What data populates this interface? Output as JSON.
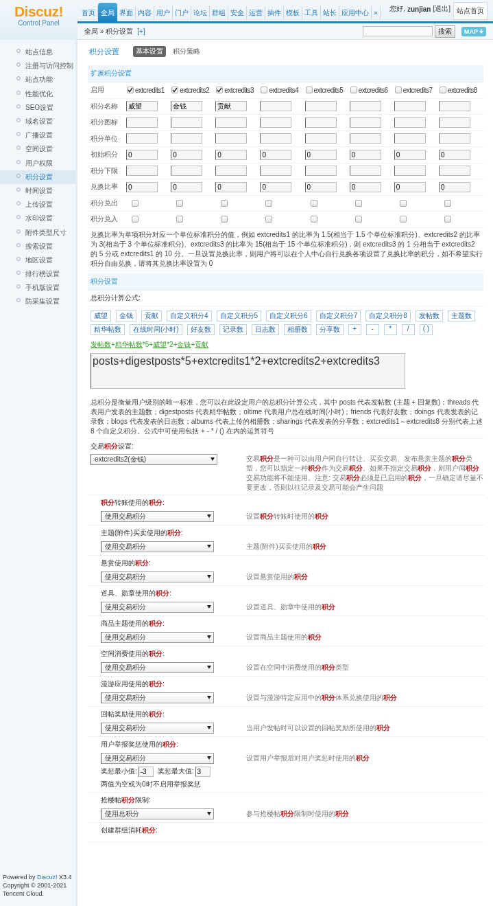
{
  "header": {
    "logo": {
      "title": "Discuz!",
      "subtitle": "Control Panel"
    },
    "nav": [
      {
        "label": "首页",
        "selected": false
      },
      {
        "label": "全局",
        "selected": true
      },
      {
        "label": "界面",
        "selected": false
      },
      {
        "label": "内容",
        "selected": false
      },
      {
        "label": "用户",
        "selected": false
      },
      {
        "label": "门户",
        "selected": false
      },
      {
        "label": "论坛",
        "selected": false
      },
      {
        "label": "群组",
        "selected": false
      },
      {
        "label": "安全",
        "selected": false
      },
      {
        "label": "运营",
        "selected": false
      },
      {
        "label": "插件",
        "selected": false
      },
      {
        "label": "模板",
        "selected": false
      },
      {
        "label": "工具",
        "selected": false
      },
      {
        "label": "站长",
        "selected": false
      },
      {
        "label": "应用中心",
        "selected": false
      },
      {
        "label": "»",
        "selected": false
      }
    ],
    "greeting": "您好,",
    "user": "zunjian",
    "logout": "[退出]",
    "home_button": "站点首页"
  },
  "toolbar": {
    "breadcrumb": "全局 » 积分设置",
    "add_link": "[+]",
    "search_button": "搜索",
    "map_button": "MAP"
  },
  "sidebar": {
    "items": [
      {
        "label": "站点信息",
        "selected": false
      },
      {
        "label": "注册与访问控制",
        "selected": false
      },
      {
        "label": "站点功能",
        "selected": false
      },
      {
        "label": "性能优化",
        "selected": false
      },
      {
        "label": "SEO设置",
        "selected": false
      },
      {
        "label": "域名设置",
        "selected": false
      },
      {
        "label": "广播设置",
        "selected": false
      },
      {
        "label": "空间设置",
        "selected": false
      },
      {
        "label": "用户权限",
        "selected": false
      },
      {
        "label": "积分设置",
        "selected": true
      },
      {
        "label": "时间设置",
        "selected": false
      },
      {
        "label": "上传设置",
        "selected": false
      },
      {
        "label": "水印设置",
        "selected": false
      },
      {
        "label": "附件类型尺寸",
        "selected": false
      },
      {
        "label": "搜索设置",
        "selected": false
      },
      {
        "label": "地区设置",
        "selected": false
      },
      {
        "label": "排行榜设置",
        "selected": false
      },
      {
        "label": "手机版设置",
        "selected": false
      },
      {
        "label": "防采集设置",
        "selected": false
      }
    ],
    "footer": {
      "powered_prefix": "Powered by",
      "powered_link": "Discuz!",
      "powered_suffix": "X3.4",
      "copyright": "Copyright © 2001-2021",
      "company": "Tencent Cloud."
    }
  },
  "page": {
    "title": "积分设置",
    "tabs": [
      {
        "label": "基本设置",
        "selected": true
      },
      {
        "label": "积分策略",
        "selected": false
      }
    ]
  },
  "ext": {
    "heading": "扩展积分设置",
    "rows": [
      {
        "kind": "enable",
        "label": "启用",
        "cells": [
          {
            "label": "extcredits1",
            "checked": true
          },
          {
            "label": "extcredits2",
            "checked": true
          },
          {
            "label": "extcredits3",
            "checked": true
          },
          {
            "label": "extcredits4",
            "checked": false
          },
          {
            "label": "extcredits5",
            "checked": false
          },
          {
            "label": "extcredits6",
            "checked": false
          },
          {
            "label": "extcredits7",
            "checked": false
          },
          {
            "label": "extcredits8",
            "checked": false
          }
        ]
      },
      {
        "kind": "input",
        "label": "积分名称",
        "values": [
          "威望",
          "金钱",
          "贡献"
        ]
      },
      {
        "kind": "input",
        "label": "积分图标"
      },
      {
        "kind": "input",
        "label": "积分单位"
      },
      {
        "kind": "input",
        "label": "初始积分",
        "values": [
          "0",
          "0",
          "0",
          "0",
          "0",
          "0",
          "0",
          "0"
        ]
      },
      {
        "kind": "input",
        "label": "积分下限"
      },
      {
        "kind": "input",
        "label": "兑换比率",
        "values": [
          "0",
          "0",
          "0",
          "0",
          "0",
          "0",
          "0",
          "0"
        ]
      },
      {
        "kind": "checks",
        "label": "积分兑出",
        "checked": [
          false,
          false,
          false,
          false,
          false,
          false,
          false,
          false
        ]
      },
      {
        "kind": "checks",
        "label": "积分兑入",
        "checked": [
          false,
          false,
          false,
          false,
          false,
          false,
          false,
          false
        ]
      }
    ],
    "note": "兑换比率为单项积分对应一个单位标准积分的值，例如 extcredits1 的比率为 1.5(相当于 1.5 个单位标准积分)、extcredits2 的比率为 3(相当于 3 个单位标准积分)、extcredits3 的比率为 15(相当于 15 个单位标准积分)，则 extcredits3 的 1 分相当于 extcredits2 的 5 分或 extcredits1 的 10 分。一旦设置兑换比率，则用户将可以在个人中心自行兑换各项设置了兑换比率的积分，如不希望实行积分自由兑换，请将其兑换比率设置为 0"
  },
  "credits": {
    "heading": "积分设置",
    "formula_label": "总积分计算公式:",
    "tokens": [
      "威望",
      "金钱",
      "贡献",
      "自定义积分4",
      "自定义积分5",
      "自定义积分6",
      "自定义积分7",
      "自定义积分8",
      "发帖数",
      "主题数",
      "精华帖数",
      "在线时间(小时)",
      "好友数",
      "记录数",
      "日志数",
      "相册数",
      "分享数",
      "+",
      "-",
      "*",
      "/",
      "( )"
    ],
    "preview": [
      {
        "kind": "link",
        "text": "发帖数"
      },
      {
        "kind": "op",
        "text": "+"
      },
      {
        "kind": "link",
        "text": "精华帖数"
      },
      {
        "kind": "op",
        "text": "*5+"
      },
      {
        "kind": "link",
        "text": "威望"
      },
      {
        "kind": "op",
        "text": "*2+"
      },
      {
        "kind": "link",
        "text": "金钱"
      },
      {
        "kind": "op",
        "text": "+"
      },
      {
        "kind": "link",
        "text": "贡献"
      }
    ],
    "formula": "posts+digestposts*5+extcredits1*2+extcredits2+extcredits3",
    "note": "总积分是衡量用户级别的唯一标准，您可以在此设定用户的总积分计算公式，其中 posts 代表发帖数 (主题 + 回复数)；threads 代表用户发表的主题数；digestposts 代表精华帖数；oltime 代表用户总在线时间(小时)；friends 代表好友数；doings 代表发表的记录数；blogs 代表发表的日志数；albums 代表上传的相册数；sharings 代表发表的分享数；extcredits1～extcredits8 分别代表上述 8 个自定义积分。公式中可使用包括 + - * / () 在内的运算符号"
  },
  "trade": {
    "label": "交易**积分**设置:",
    "select": "extcredits2(金钱)",
    "description": "交易**积分**是一种可以由用户间自行转让、买卖交易、发布悬赏主题的**积分**类型，您可以指定一种**积分**作为交易**积分**。如果不指定交易**积分**，则用户间**积分**交易功能将不能使用。注意: 交易**积分**必须是已启用的**积分**，一旦确定请尽量不要更改，否则以往记录及交易可能会产生问题"
  },
  "settings": [
    {
      "label": "**积分**转账使用的**积分**:",
      "select": "使用交易积分",
      "description": "设置**积分**转账时使用的**积分**"
    },
    {
      "label": "主题(附件)买卖使用的**积分**:",
      "select": "使用交易积分",
      "description": "主题(附件)买卖使用的**积分**"
    },
    {
      "label": "悬赏使用的**积分**:",
      "select": "使用交易积分",
      "description": "设置悬赏使用的**积分**"
    },
    {
      "label": "道具、勋章使用的**积分**:",
      "select": "使用交易积分",
      "description": "设置道具、勋章中使用的**积分**"
    },
    {
      "label": "商品主题使用的**积分**:",
      "select": "使用交易积分",
      "description": "设置商品主题使用的**积分**"
    },
    {
      "label": "空间消费使用的**积分**:",
      "select": "使用交易积分",
      "description": "设置在空间中消费使用的**积分**类型"
    },
    {
      "label": "漫游应用使用的**积分**:",
      "select": "使用交易积分",
      "description": "设置与漫游特定应用中的**积分**体系兑换使用的**积分**"
    },
    {
      "label": "回帖奖励使用的**积分**:",
      "select": "使用交易积分",
      "description": "当用户发帖时可以设置的回帖奖励所使用的**积分**"
    },
    {
      "label": "用户举报奖惩使用的**积分**:",
      "select": "使用交易积分",
      "description": "设置用户举报后对用户奖惩时使用的**积分**",
      "range": {
        "min_label": "奖惩最小值:",
        "min": "-3",
        "max_label": "奖惩最大值:",
        "max": "3",
        "note": "两值为空或为0时不启用举报奖惩"
      }
    },
    {
      "label": "抢楼帖**积分**限制:",
      "select": "使用总积分",
      "description": "参与抢楼帖**积分**限制时使用的**积分**"
    },
    {
      "label": "创建群组消耗**积分**:"
    }
  ]
}
